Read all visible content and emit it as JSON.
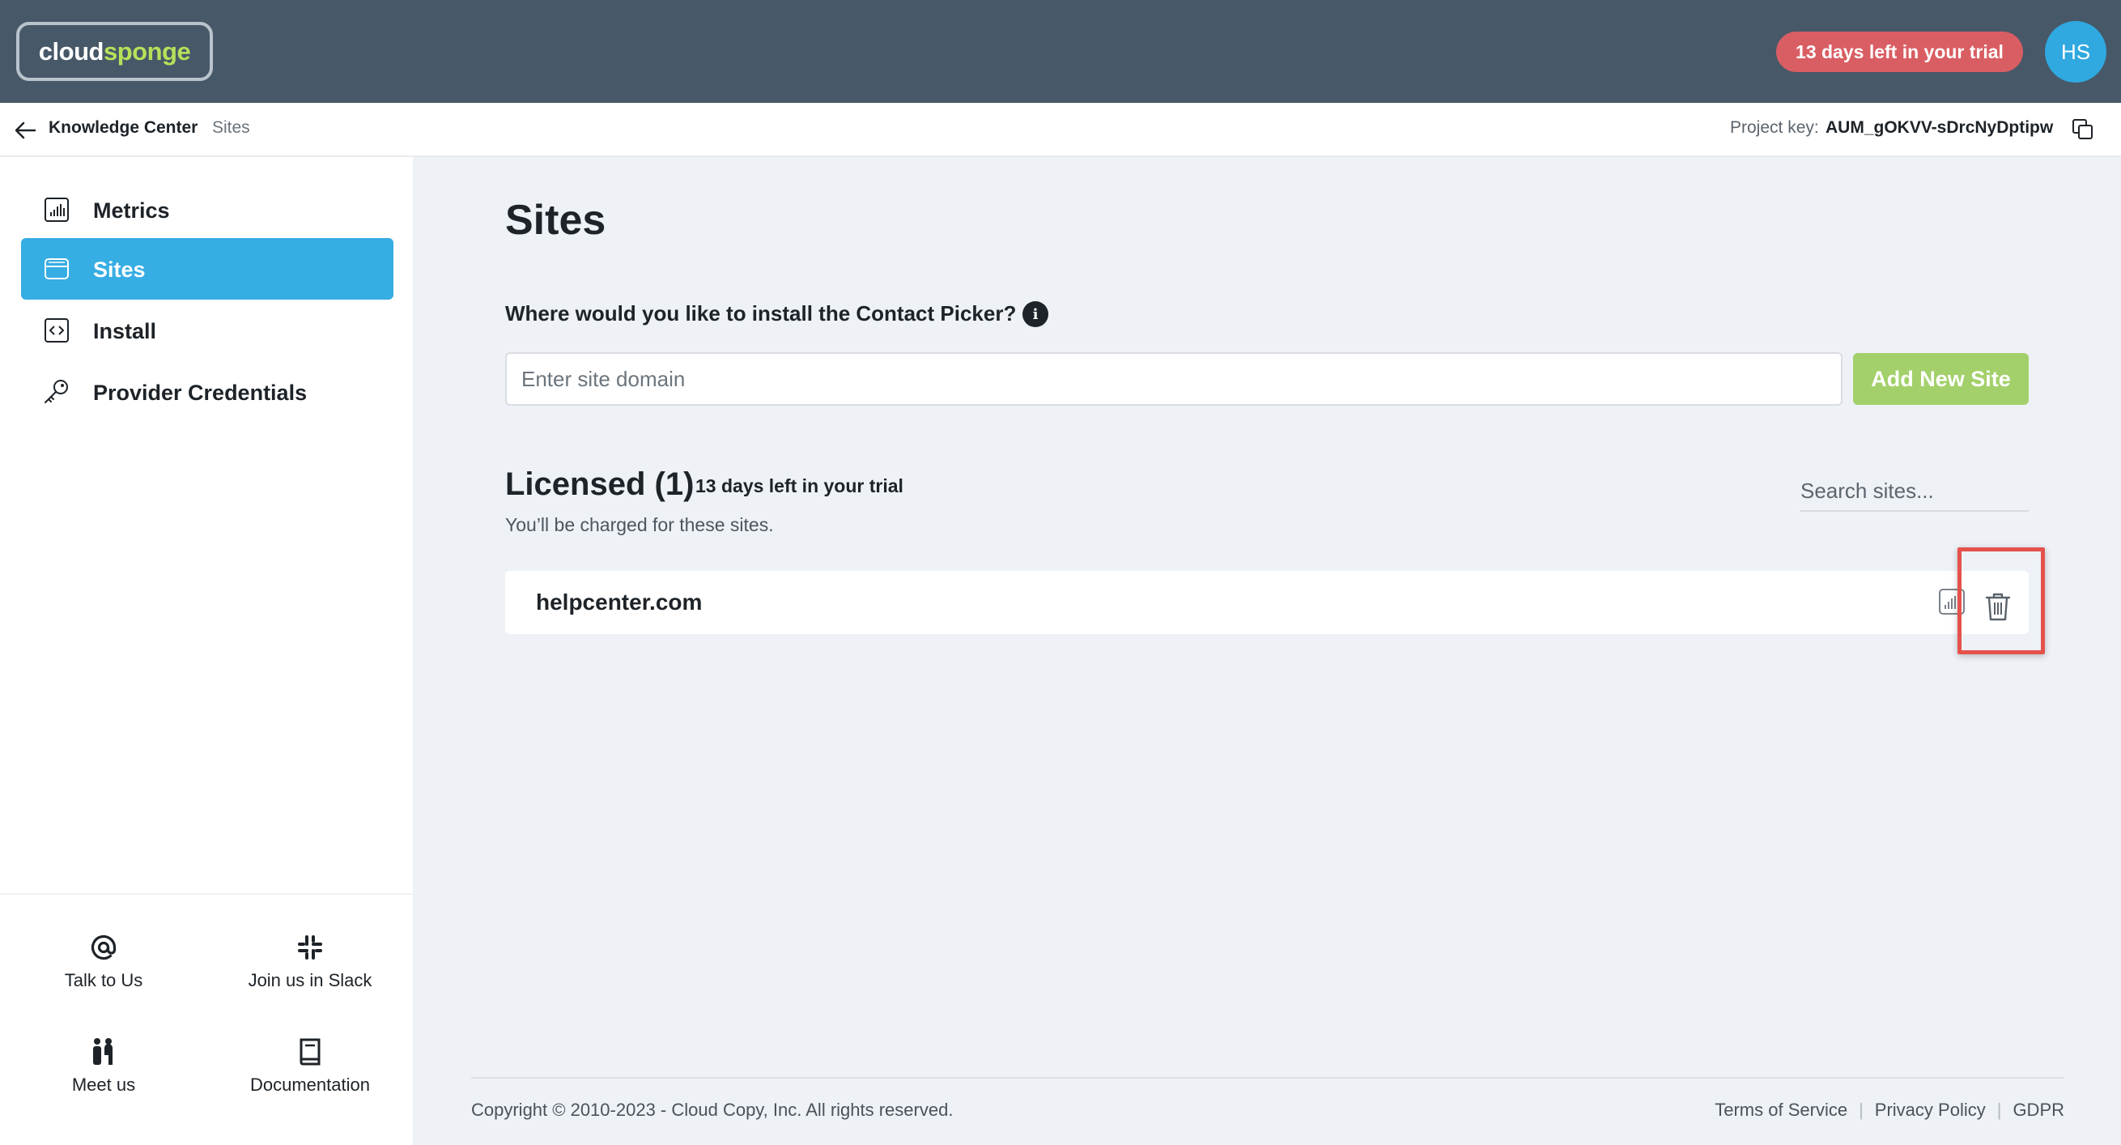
{
  "header": {
    "logo_part1": "cloud",
    "logo_part2": "sponge",
    "trial_badge": "13 days left in your trial",
    "avatar_initials": "HS"
  },
  "subheader": {
    "breadcrumb_main": "Knowledge Center",
    "breadcrumb_current": "Sites",
    "project_key_label": "Project key:",
    "project_key_value": "AUM_gOKVV-sDrcNyDptipw"
  },
  "sidebar": {
    "items": [
      {
        "label": "Metrics",
        "icon": "bar-chart-icon",
        "active": false
      },
      {
        "label": "Sites",
        "icon": "browser-window-icon",
        "active": true
      },
      {
        "label": "Install",
        "icon": "code-icon",
        "active": false
      },
      {
        "label": "Provider Credentials",
        "icon": "key-icon",
        "active": false
      }
    ],
    "help_links": [
      {
        "label": "Talk to Us",
        "icon": "at-sign-icon"
      },
      {
        "label": "Join us in Slack",
        "icon": "slack-icon"
      },
      {
        "label": "Meet us",
        "icon": "people-icon"
      },
      {
        "label": "Documentation",
        "icon": "book-icon"
      }
    ]
  },
  "main": {
    "title": "Sites",
    "question": "Where would you like to install the Contact Picker?",
    "domain_placeholder": "Enter site domain",
    "add_button": "Add New Site",
    "licensed_title": "Licensed (1)",
    "licensed_trial": "13 days left in your trial",
    "licensed_note": "You’ll be charged for these sites.",
    "search_placeholder": "Search sites...",
    "sites": [
      {
        "domain": "helpcenter.com"
      }
    ]
  },
  "footer": {
    "copyright": "Copyright © 2010-2023 - Cloud Copy, Inc. All rights reserved.",
    "links": [
      "Terms of Service",
      "Privacy Policy",
      "GDPR"
    ],
    "separator": "|"
  },
  "colors": {
    "topbar": "#475868",
    "accent_blue": "#36ade3",
    "trial_red": "#d95e63",
    "add_green": "#a3d06b",
    "highlight_red": "#e5524c"
  }
}
